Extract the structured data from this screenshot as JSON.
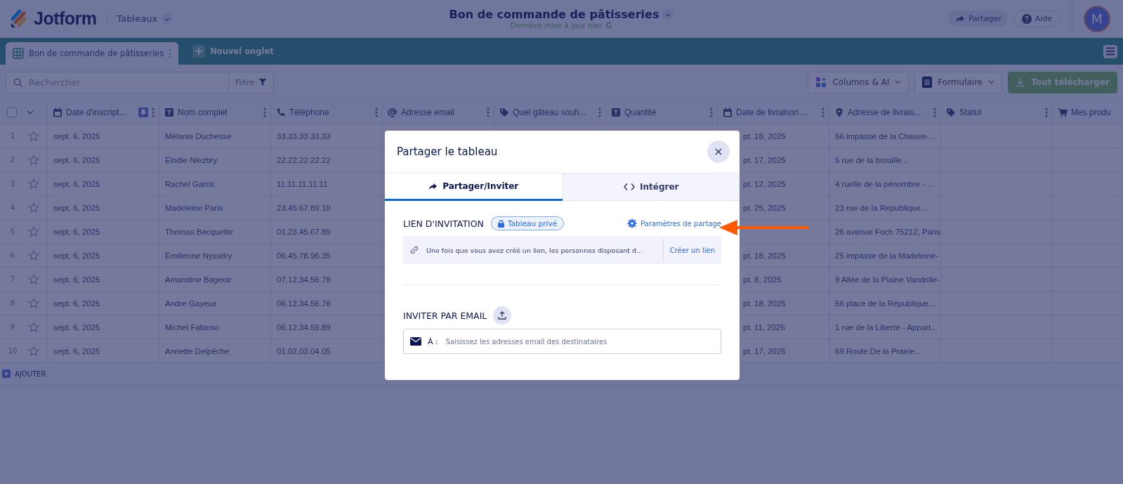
{
  "header": {
    "logo": "Jotform",
    "menu": "Tableaux",
    "title": "Bon de commande de pâtisseries",
    "subtitle": "Dernière mise à jour hier",
    "share": "Partager",
    "help": "Aide",
    "avatar": "M"
  },
  "tabs": [
    {
      "label": "Bon de commande de pâtisseries",
      "selected": true
    },
    {
      "label": "Nouvel onglet",
      "selected": false
    }
  ],
  "toolbar": {
    "search": {
      "placeholder": "Rechercher"
    },
    "filter": "Filtre",
    "buttons": [
      {
        "kind": "columns",
        "label": "Columns & AI"
      },
      {
        "kind": "form",
        "label": "Formulaire"
      },
      {
        "kind": "download",
        "label": "Tout télécharger"
      }
    ]
  },
  "table": {
    "select_all": {
      "checked": false
    },
    "columns": [
      {
        "kind": "date",
        "label": "Date d'inscript...",
        "pinned": true
      },
      {
        "kind": "text",
        "label": "Nom complet",
        "pinned": false
      },
      {
        "kind": "phone",
        "label": "Téléphone",
        "pinned": false
      },
      {
        "kind": "email",
        "label": "Adresse email",
        "pinned": false
      },
      {
        "kind": "tag",
        "label": "Quel gâteau souh...",
        "pinned": false
      },
      {
        "kind": "text",
        "label": "Quantité",
        "pinned": false
      },
      {
        "kind": "date",
        "label": "Date de livraison ...",
        "pinned": false
      },
      {
        "kind": "location",
        "label": "Adresse de livrais...",
        "pinned": false
      },
      {
        "kind": "tag",
        "label": "Statut",
        "pinned": false
      },
      {
        "kind": "cart",
        "label": "Mes produ",
        "pinned": false
      }
    ],
    "rows": [
      {
        "number": "1",
        "starred": false,
        "date": "sept. 6, 2025",
        "name": "Mélanie Duchesse",
        "phone": "33.33.33.33.33",
        "delivery": "pt. 18, 2025",
        "address": "56 impasse de la Chauve-..."
      },
      {
        "number": "2",
        "starred": false,
        "date": "sept. 6, 2025",
        "name": "Élodie Niezbry",
        "phone": "22.22.22.22.22",
        "delivery": "pt. 17, 2025",
        "address": "5 rue de la brouille..."
      },
      {
        "number": "3",
        "starred": false,
        "date": "sept. 6, 2025",
        "name": "Rachel Garris",
        "phone": "11.11.11.11.11",
        "delivery": "pt. 12, 2025",
        "address": "4 ruelle de la pénombre - ..."
      },
      {
        "number": "4",
        "starred": false,
        "date": "sept. 6, 2025",
        "name": "Madeleine Paris",
        "phone": "23.45.67.89.10",
        "delivery": "pt. 25, 2025",
        "address": "23 rue de la République..."
      },
      {
        "number": "5",
        "starred": false,
        "date": "sept. 6, 2025",
        "name": "Thomas Becquette",
        "phone": "01.23.45.67.89",
        "address": "26 avenue Foch  75212, Paris"
      },
      {
        "number": "6",
        "starred": false,
        "date": "sept. 6, 2025",
        "name": "Émilienne Nyssdry",
        "phone": "06.45.78.96.35",
        "delivery": "pt. 18, 2025",
        "address": "25 impasse de la Madeleine-"
      },
      {
        "number": "7",
        "starred": false,
        "date": "sept. 6, 2025",
        "name": "Amandine Bageoir",
        "phone": "07.12.34.56.78",
        "delivery": "pt. 8, 2025",
        "address": "9 Allée de la Plaine Vandrille-"
      },
      {
        "number": "8",
        "starred": false,
        "date": "sept. 6, 2025",
        "name": "Andre Gayeux",
        "phone": "06.12.34.56.78",
        "delivery": "pt. 18, 2025",
        "address": "56 place de la République..."
      },
      {
        "number": "9",
        "starred": false,
        "date": "sept. 6, 2025",
        "name": "Michel Fabioso",
        "phone": "06.12.34.59.89",
        "delivery": "pt. 11, 2025",
        "address": "1 rue de la Liberté - Appart..."
      },
      {
        "number": "10",
        "starred": false,
        "date": "sept. 6, 2025",
        "name": "Annette Delpêche",
        "phone": "01.02.03.04.05",
        "delivery": "pt. 17, 2025",
        "address": "69 Route De la Prairie..."
      }
    ],
    "add_row": "AJOUTER"
  },
  "modal": {
    "title": "Partager le tableau",
    "tabs": [
      {
        "kind": "share",
        "label": "Partager/Inviter",
        "selected": true
      },
      {
        "kind": "code",
        "label": "Intégrer",
        "selected": false
      }
    ],
    "invite_link": {
      "label": "LIEN D'INVITATION",
      "badge": "Tableau privé",
      "settings": "Paramètres de partage",
      "info": "Une fois que vous avez créé un lien, les personnes disposant d...",
      "create": "Créer un lien"
    },
    "invite_email": {
      "label": "INVITER PAR EMAIL",
      "to": "À :",
      "placeholder": "Saisissez les adresses email des destinataires"
    }
  }
}
